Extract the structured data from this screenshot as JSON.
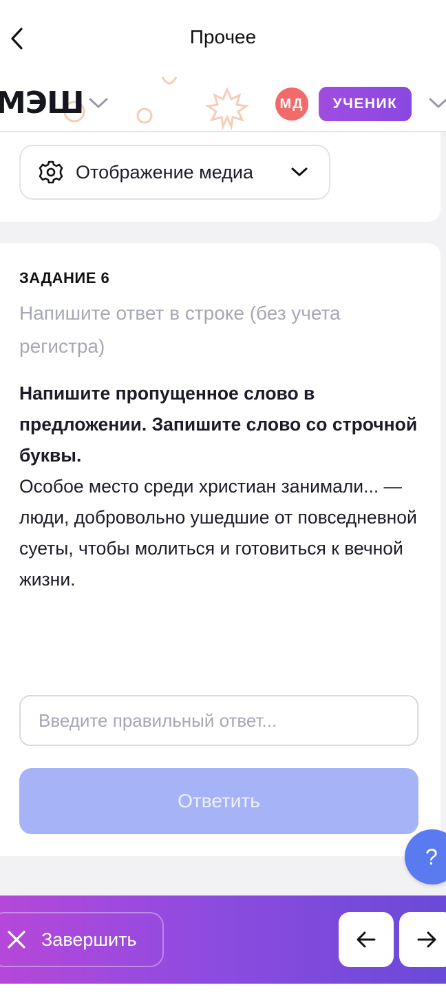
{
  "header": {
    "title": "Прочее"
  },
  "brand": {
    "logo_text": "МЭШ",
    "avatar_initials": "МД",
    "role_badge": "УЧЕНИК"
  },
  "media": {
    "label": "Отображение медиа"
  },
  "task": {
    "number_label": "ЗАДАНИЕ 6",
    "hint": "Напишите ответ в строке (без учета регистра)",
    "instruction": "Напишите пропущенное слово в предложении. Запишите слово со строчной буквы.",
    "text": "Особое место среди христиан занимали... — люди, добровольно ушедшие от повседневной суеты, чтобы молиться и готовиться к вечной жизни.",
    "answer_placeholder": "Введите правильный ответ...",
    "answer_value": "",
    "submit_label": "Ответить"
  },
  "help": {
    "label": "?"
  },
  "footer": {
    "finish_label": "Завершить"
  },
  "colors": {
    "accent": "#8a48e0",
    "avatar": "#f26a6a",
    "submit_disabled": "#a6b4f7",
    "help": "#5a7bf0"
  },
  "icons": {
    "back": "chevron-left-icon",
    "media": "gear-icon",
    "finish": "close-icon",
    "prev": "arrow-left-icon",
    "next": "arrow-right-icon"
  }
}
